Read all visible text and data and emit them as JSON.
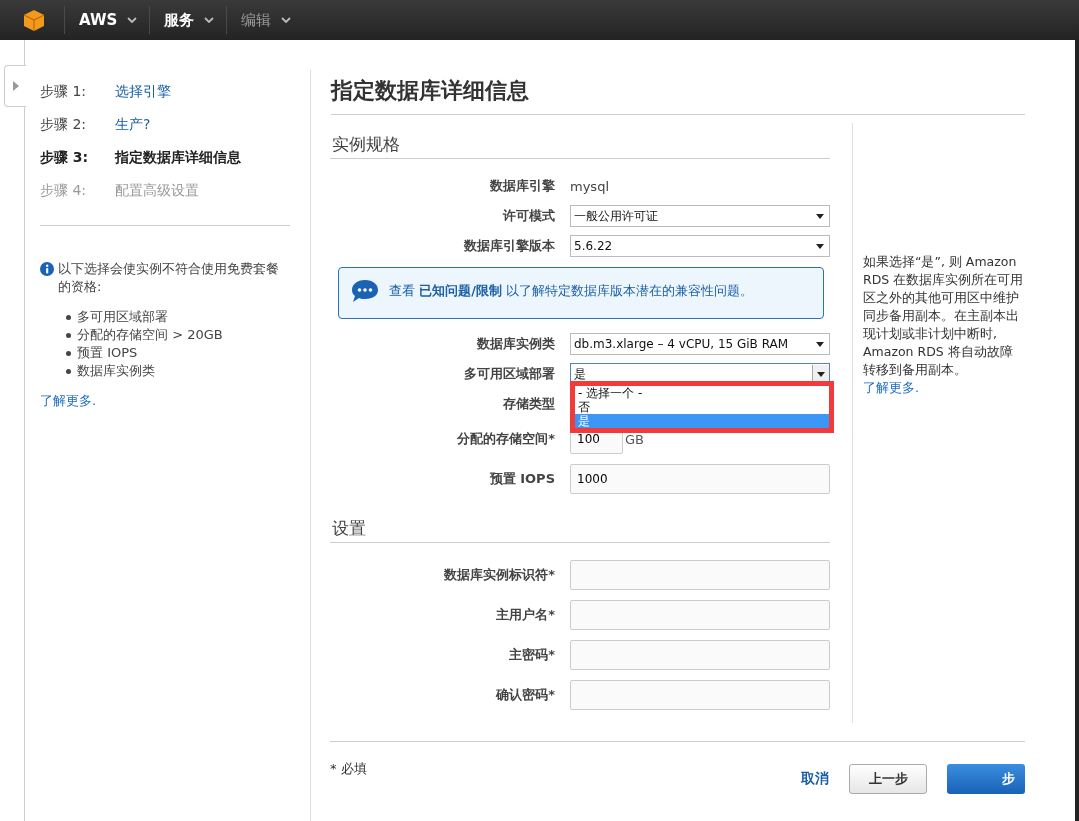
{
  "topbar": {
    "items": [
      {
        "label": "AWS",
        "disabled": false
      },
      {
        "label": "服务",
        "disabled": false
      },
      {
        "label": "编辑",
        "disabled": true
      }
    ]
  },
  "steps": [
    {
      "number": "步骤 1:",
      "label": "选择引擎",
      "kind": "link"
    },
    {
      "number": "步骤 2:",
      "label": "生产?",
      "kind": "link"
    },
    {
      "number": "步骤 3:",
      "label": "指定数据库详细信息",
      "kind": "current"
    },
    {
      "number": "步骤 4:",
      "label": "配置高级设置",
      "kind": "pending"
    }
  ],
  "free_tier": {
    "note": "以下选择会使实例不符合使用免费套餐的资格:",
    "items": [
      "多可用区域部署",
      "分配的存储空间 > 20GB",
      "预置 IOPS",
      "数据库实例类"
    ],
    "link": "了解更多."
  },
  "title": "指定数据库详细信息",
  "sections": [
    {
      "heading": "实例规格",
      "fields": [
        {
          "kind": "text",
          "label": "数据库引擎",
          "value": "mysql"
        },
        {
          "kind": "select",
          "label": "许可模式",
          "value": "一般公用许可证",
          "expanded": false
        },
        {
          "kind": "select",
          "label": "数据库引擎版本",
          "value": "5.6.22",
          "expanded": false
        },
        {
          "kind": "notice",
          "prefix": "查看",
          "link": "已知问题/限制",
          "text": "以了解特定数据库版本潜在的兼容性问题。"
        },
        {
          "kind": "select",
          "label": "数据库实例类",
          "value": "db.m3.xlarge – 4 vCPU, 15 GiB RAM",
          "expanded": false
        },
        {
          "kind": "select",
          "label": "多可用区域部署",
          "value": "是",
          "expanded": true,
          "options": [
            {
              "label": "- 选择一个 -",
              "selected": false
            },
            {
              "label": "否",
              "selected": false
            },
            {
              "label": "是",
              "selected": true
            }
          ]
        },
        {
          "kind": "label",
          "label": "存储类型"
        },
        {
          "kind": "input",
          "label": "分配的存储空间*",
          "value": "100",
          "unit": "GB"
        },
        {
          "kind": "input",
          "label": "预置 IOPS",
          "value": "1000"
        }
      ]
    },
    {
      "heading": "设置",
      "fields": [
        {
          "kind": "input",
          "label": "数据库实例标识符*"
        },
        {
          "kind": "input",
          "label": "主用户名*"
        },
        {
          "kind": "input",
          "label": "主密码*"
        },
        {
          "kind": "input",
          "label": "确认密码*"
        }
      ]
    }
  ],
  "help": {
    "text": "如果选择“是”, 则 Amazon RDS 在数据库实例所在可用区之外的其他可用区中维护同步备用副本。在主副本出现计划或非计划中断时, Amazon RDS 将自动故障转移到备用副本。",
    "link": "了解更多."
  },
  "footer": {
    "required_note": "* 必填",
    "cancel": "取消",
    "back": "上一步",
    "next": "步"
  }
}
